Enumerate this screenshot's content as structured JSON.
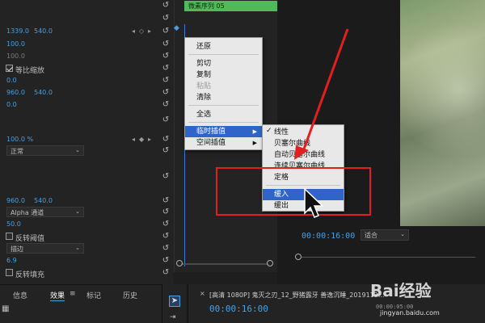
{
  "effects_panel": {
    "rows": [
      {
        "v1": "1339.0",
        "v2": "540.0"
      },
      {
        "v1": "100.0"
      },
      {
        "v1": "100.0"
      },
      {
        "check_label": "等比缩放"
      },
      {
        "v1": "0.0"
      },
      {
        "v1": "960.0",
        "v2": "540.0"
      },
      {
        "v1": "0.0"
      },
      {
        "v1": "100.0 %"
      },
      {
        "dropdown": "正常"
      },
      {
        "v1": "960.0",
        "v2": "540.0"
      },
      {
        "dropdown": "Alpha 通道"
      },
      {
        "v1": "50.0"
      },
      {
        "check_label": "反转阈值"
      },
      {
        "dropdown": "描边"
      },
      {
        "v1": "6.9"
      },
      {
        "check_label": "反转填充"
      }
    ]
  },
  "timeline": {
    "sequence_label": "微素序列 05"
  },
  "context_menu": {
    "items": [
      "还原",
      "剪切",
      "复制",
      "粘贴",
      "清除",
      "全选",
      "临时插值",
      "空间插值"
    ]
  },
  "submenu": {
    "items": [
      "线性",
      "贝塞尔曲线",
      "自动贝塞尔曲线",
      "连续贝塞尔曲线",
      "定格",
      "缓入",
      "缓出"
    ]
  },
  "program_monitor": {
    "timecode": "00:00:16:00",
    "fit": "适合"
  },
  "bottom_tabs": [
    "信息",
    "效果",
    "标记",
    "历史"
  ],
  "sequence_panel": {
    "title": "[高清 1080P] 鬼灭之刃_12_野猪露牙 善逸沉睡_2019112...",
    "timecode": "00:00:16:00",
    "right_timecode": "00:00:05:00"
  },
  "watermark": {
    "brand": "Bai经验",
    "url": "jingyan.baidu.com"
  },
  "colors": {
    "accent_blue": "#4a9fe0",
    "sequence_green": "#52b85c",
    "annotation_red": "#e02020",
    "menu_highlight": "#2f64c8"
  }
}
